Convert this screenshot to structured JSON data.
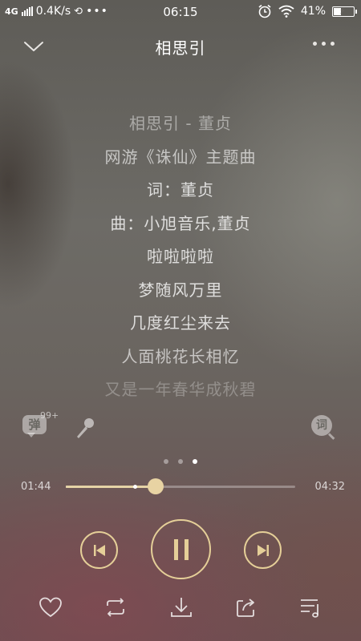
{
  "status_bar": {
    "network": "4G",
    "speed": "0.4K/s",
    "time": "06:15",
    "battery": "41%",
    "battery_level": 0.41
  },
  "header": {
    "title": "相思引"
  },
  "lyrics": [
    "相思引 - 董贞",
    "网游《诛仙》主题曲",
    "词：董贞",
    "曲：小旭音乐,董贞",
    "啦啦啦啦",
    "梦随风万里",
    "几度红尘来去",
    "人面桃花长相忆",
    "又是一年春华成秋碧"
  ],
  "tools": {
    "danmu_label": "弹",
    "danmu_badge": "99+",
    "lyric_search_label": "词"
  },
  "pager": {
    "count": 3,
    "active_index": 2
  },
  "progress": {
    "current_time": "01:44",
    "total_time": "04:32",
    "played_fraction": 0.39,
    "buffered_fraction": 0.3
  },
  "colors": {
    "accent": "#e5cf98"
  },
  "icons": {
    "back": "chevron-down-icon",
    "more": "more-icon",
    "danmu": "danmu-icon",
    "mic": "microphone-icon",
    "lyric_search": "lyric-search-icon",
    "prev": "previous-icon",
    "pause": "pause-icon",
    "next": "next-icon",
    "like": "heart-icon",
    "repeat": "repeat-icon",
    "download": "download-icon",
    "share": "share-icon",
    "playlist": "playlist-icon"
  }
}
